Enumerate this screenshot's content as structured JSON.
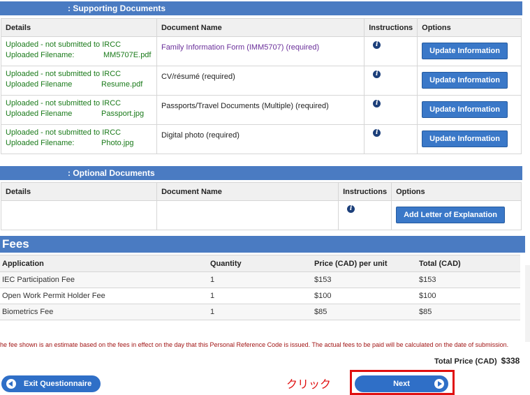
{
  "supporting": {
    "title": ": Supporting Documents",
    "headers": [
      "Details",
      "Document Name",
      "Instructions",
      "Options"
    ],
    "rows": [
      {
        "status": "Uploaded - not submitted to IRCC",
        "file_label": "Uploaded Filename:",
        "file_name": "MM5707E.pdf",
        "doc": "Family Information Form (IMM5707)  (required)",
        "button": "Update Information"
      },
      {
        "status": "Uploaded - not submitted to IRCC",
        "file_label": "Uploaded Filename",
        "file_name": "Resume.pdf",
        "doc": "CV/résumé  (required)",
        "button": "Update Information"
      },
      {
        "status": "Uploaded - not submitted to IRCC",
        "file_label": "Uploaded Filename",
        "file_name": "Passport.jpg",
        "doc": "Passports/Travel Documents (Multiple)  (required)",
        "button": "Update Information"
      },
      {
        "status": "Uploaded - not submitted to IRCC",
        "file_label": "Uploaded Filename:",
        "file_name": "Photo.jpg",
        "doc": "Digital photo  (required)",
        "button": "Update Information"
      }
    ]
  },
  "optional": {
    "title": ": Optional Documents",
    "headers": [
      "Details",
      "Document Name",
      "Instructions",
      "Options"
    ],
    "button": "Add Letter of Explanation"
  },
  "fees": {
    "title": "Fees",
    "headers": [
      "Application",
      "Quantity",
      "Price (CAD) per unit",
      "Total (CAD)"
    ],
    "rows": [
      [
        "IEC Participation Fee",
        "1",
        "$153",
        "$153"
      ],
      [
        "Open Work Permit Holder Fee",
        "1",
        "$100",
        "$100"
      ],
      [
        "Biometrics Fee",
        "1",
        "$85",
        "$85"
      ]
    ],
    "disclaimer": "he fee shown is an estimate based on the fees in effect on the day that this Personal Reference Code is issued. The actual fees to be paid will be calculated on the date of submission.",
    "total_label": "Total Price (CAD)",
    "total_value": "$338"
  },
  "footer": {
    "exit_label": "Exit Questionnaire",
    "next_label": "Next",
    "annotation": "クリック"
  },
  "icons": {
    "info": "info-icon",
    "back": "circle-left-arrow-icon",
    "forward": "circle-right-arrow-icon"
  },
  "colors": {
    "section_bar": "#4a7bc2",
    "button_blue": "#3a78c8",
    "status_green": "#1a7a1a",
    "doc_purple": "#6a2f9a",
    "annotation_red": "#e01010"
  }
}
